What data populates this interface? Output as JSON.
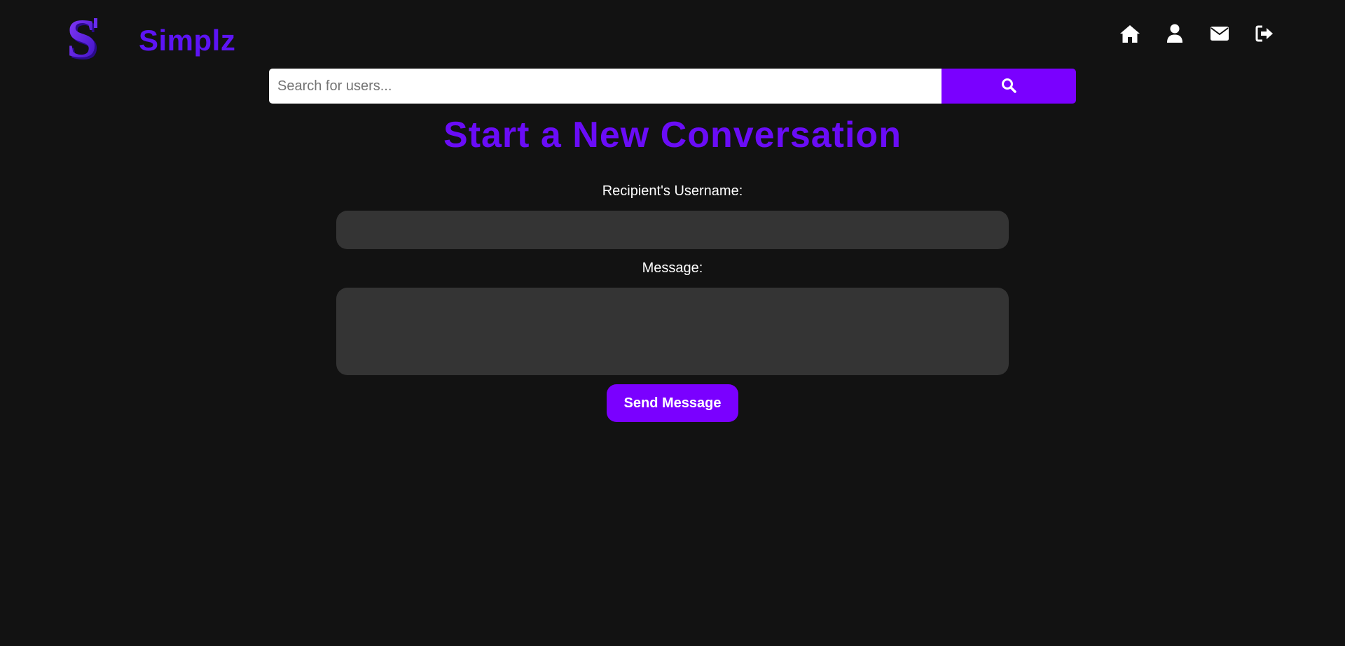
{
  "header": {
    "brand": "Simplz",
    "logo_icon": "s-logo-icon",
    "nav": [
      {
        "icon": "home-icon"
      },
      {
        "icon": "user-icon"
      },
      {
        "icon": "envelope-icon"
      },
      {
        "icon": "sign-out-icon"
      }
    ]
  },
  "search": {
    "placeholder": "Search for users...",
    "value": "",
    "button_icon": "search-icon"
  },
  "page": {
    "title": "Start a New Conversation"
  },
  "form": {
    "recipient_label": "Recipient's Username:",
    "recipient_value": "",
    "message_label": "Message:",
    "message_value": "",
    "send_label": "Send Message"
  },
  "colors": {
    "background": "#121212",
    "accent": "#7a00ff",
    "brand_text": "#5d14f5",
    "title_text": "#6a0cf7",
    "field_background": "#343434"
  }
}
